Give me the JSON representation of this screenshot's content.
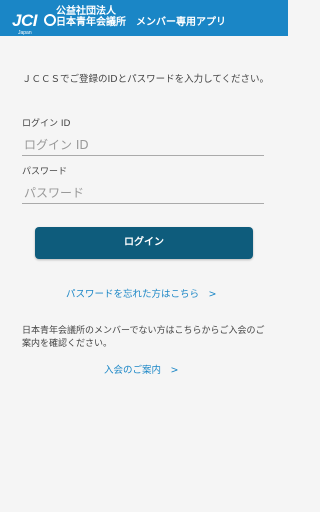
{
  "header": {
    "logo_text": "JCI",
    "logo_sub": "Japan",
    "org_line1": "公益社団法人",
    "org_line2": "日本青年会議所",
    "app_title": "メンバー専用アプリ"
  },
  "login": {
    "intro": "ＪＣＣＳでご登録のIDとパスワードを入力してください。",
    "id_label": "ログイン ID",
    "id_placeholder": "ログイン ID",
    "id_value": "",
    "password_label": "パスワード",
    "password_placeholder": "パスワード",
    "password_value": "",
    "submit_label": "ログイン",
    "forgot_link": "パスワードを忘れた方はこちら　>",
    "non_member_note": "日本青年会議所のメンバーでない方はこちらからご入会のご案内を確認ください。",
    "join_link": "入会のご案内　>"
  },
  "colors": {
    "header_bg": "#1a86c6",
    "button_bg": "#0e5c7c",
    "link": "#1a86c6"
  }
}
